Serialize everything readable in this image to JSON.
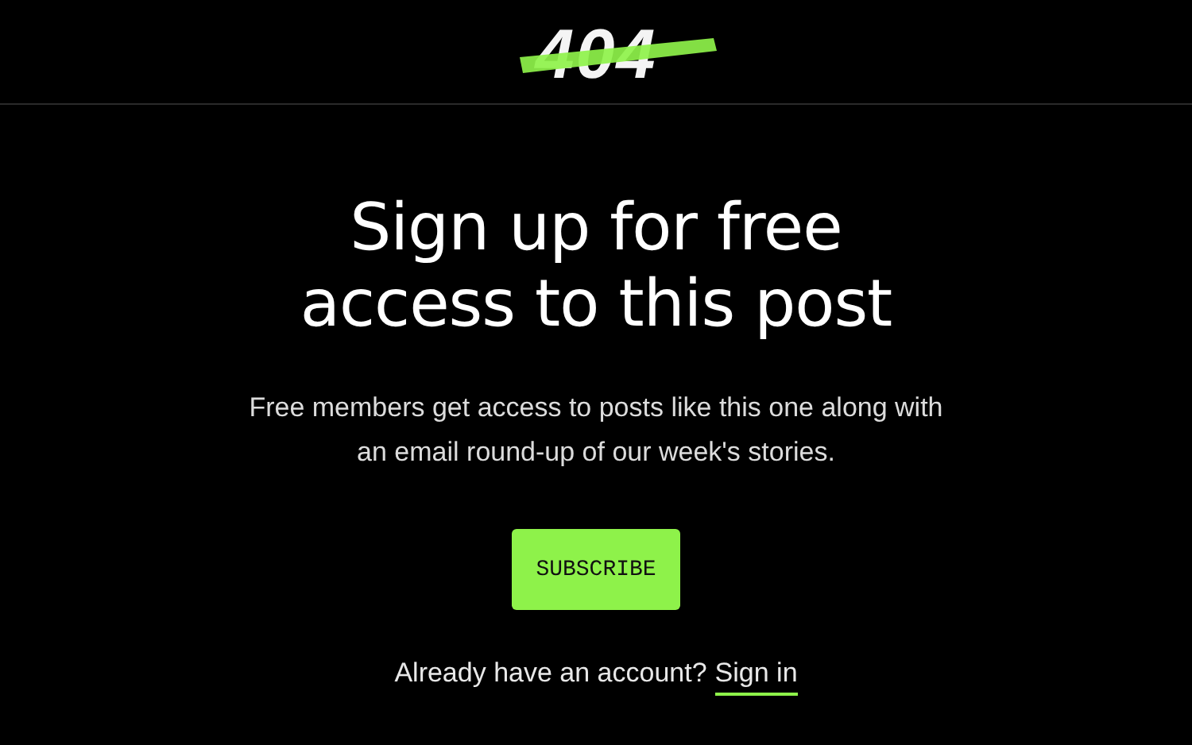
{
  "header": {
    "logo": "404"
  },
  "cta": {
    "title": "Sign up for free access to this post",
    "description": "Free members get access to posts like this one along with an email round-up of our week's stories.",
    "button": "SUBSCRIBE",
    "signin_prompt": "Already have an account?",
    "signin_link": "Sign in"
  }
}
